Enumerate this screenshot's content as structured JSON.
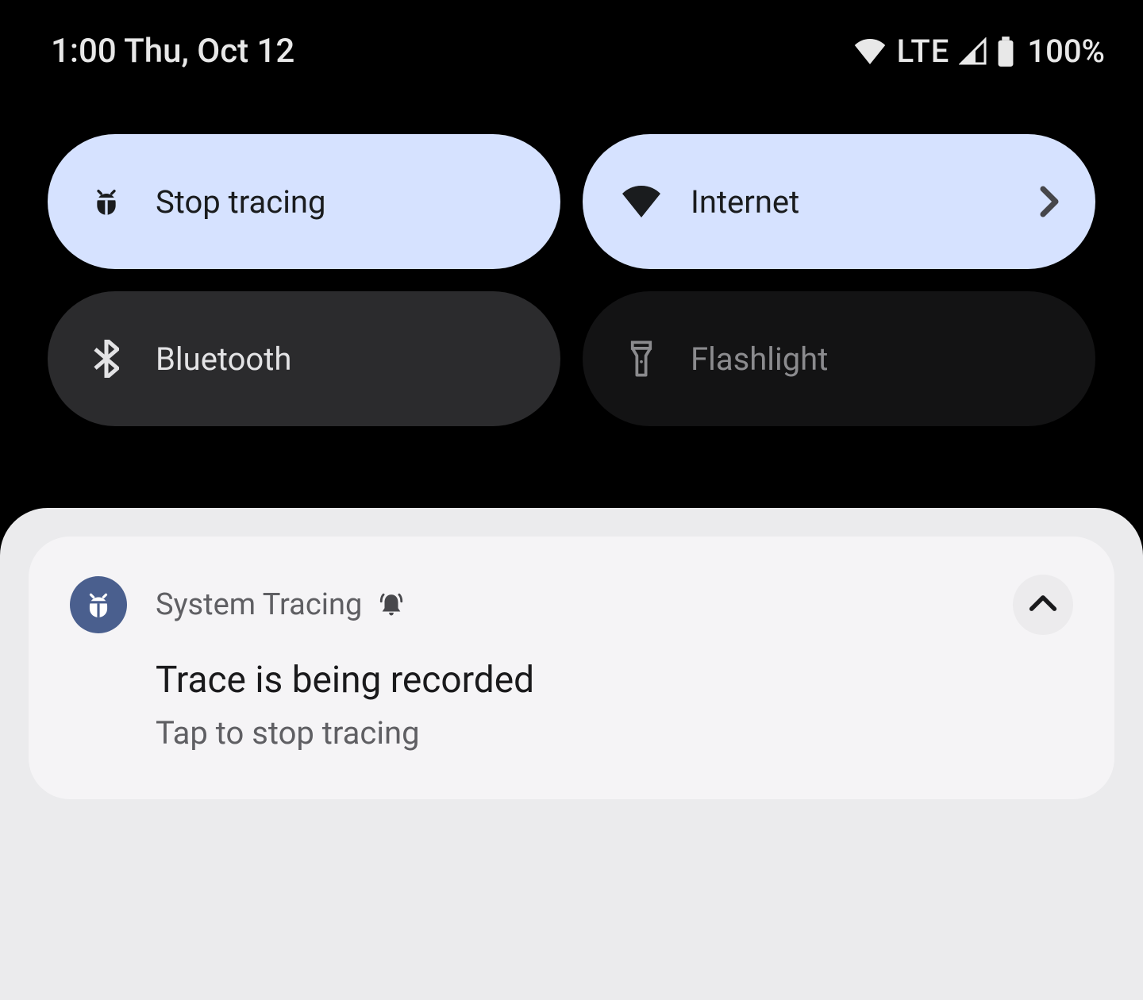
{
  "status": {
    "time_date": "1:00 Thu, Oct 12",
    "lte": "LTE",
    "battery": "100%"
  },
  "tiles": {
    "stop_tracing": "Stop tracing",
    "internet": "Internet",
    "bluetooth": "Bluetooth",
    "flashlight": "Flashlight"
  },
  "notification": {
    "app_name": "System Tracing",
    "title": "Trace is being recorded",
    "text": "Tap to stop tracing"
  }
}
